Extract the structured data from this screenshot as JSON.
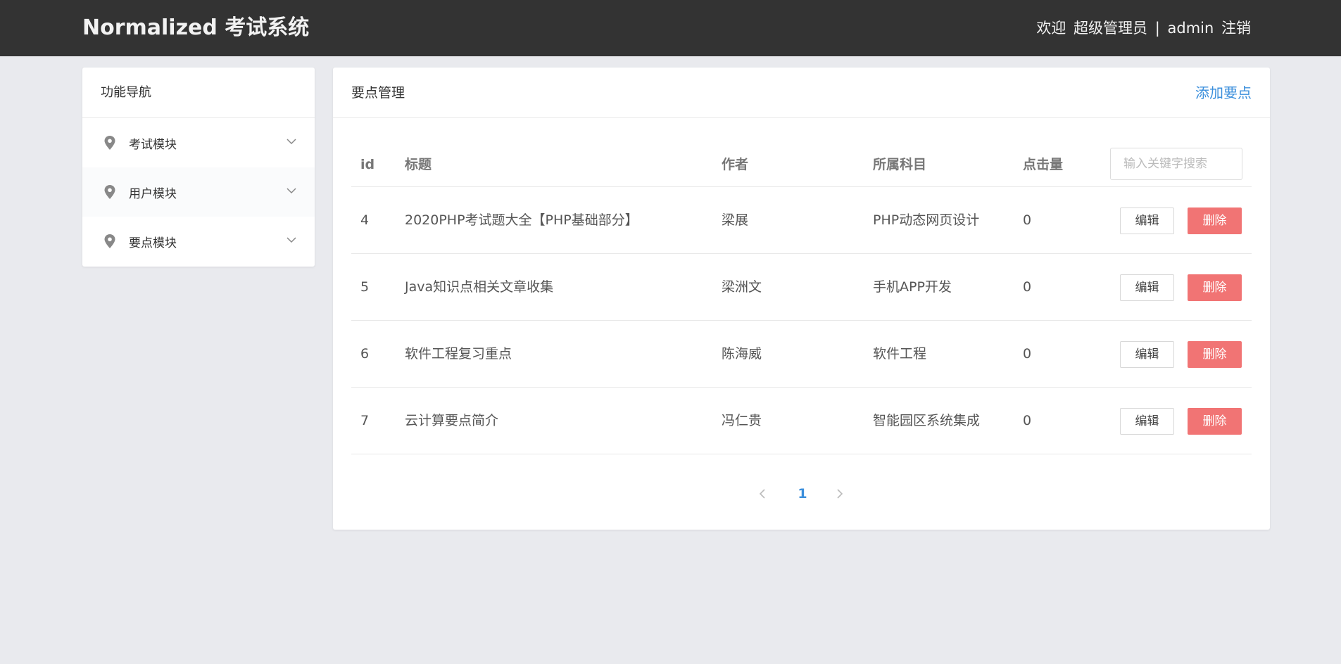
{
  "header": {
    "brand": "Normalized 考试系统",
    "welcome": "欢迎",
    "role": "超级管理员",
    "separator": "|",
    "username": "admin",
    "logout": "注销"
  },
  "sidebar": {
    "title": "功能导航",
    "items": [
      {
        "label": "考试模块",
        "icon": "location-pin-icon"
      },
      {
        "label": "用户模块",
        "icon": "location-pin-icon"
      },
      {
        "label": "要点模块",
        "icon": "location-pin-icon"
      }
    ]
  },
  "main": {
    "title": "要点管理",
    "add_label": "添加要点",
    "search": {
      "placeholder": "输入关键字搜索",
      "value": ""
    },
    "columns": [
      "id",
      "标题",
      "作者",
      "所属科目",
      "点击量"
    ],
    "rows": [
      {
        "id": "4",
        "title": "2020PHP考试题大全【PHP基础部分】",
        "author": "梁展",
        "subject": "PHP动态网页设计",
        "clicks": "0",
        "edit": "编辑",
        "delete": "删除"
      },
      {
        "id": "5",
        "title": "Java知识点相关文章收集",
        "author": "梁洲文",
        "subject": "手机APP开发",
        "clicks": "0",
        "edit": "编辑",
        "delete": "删除"
      },
      {
        "id": "6",
        "title": "软件工程复习重点",
        "author": "陈海威",
        "subject": "软件工程",
        "clicks": "0",
        "edit": "编辑",
        "delete": "删除"
      },
      {
        "id": "7",
        "title": "云计算要点简介",
        "author": "冯仁贵",
        "subject": "智能园区系统集成",
        "clicks": "0",
        "edit": "编辑",
        "delete": "删除"
      }
    ],
    "pagination": {
      "current": "1"
    }
  },
  "colors": {
    "topbar": "#333333",
    "background": "#e9eaee",
    "accent": "#3b8fdc",
    "danger": "#f17474"
  }
}
